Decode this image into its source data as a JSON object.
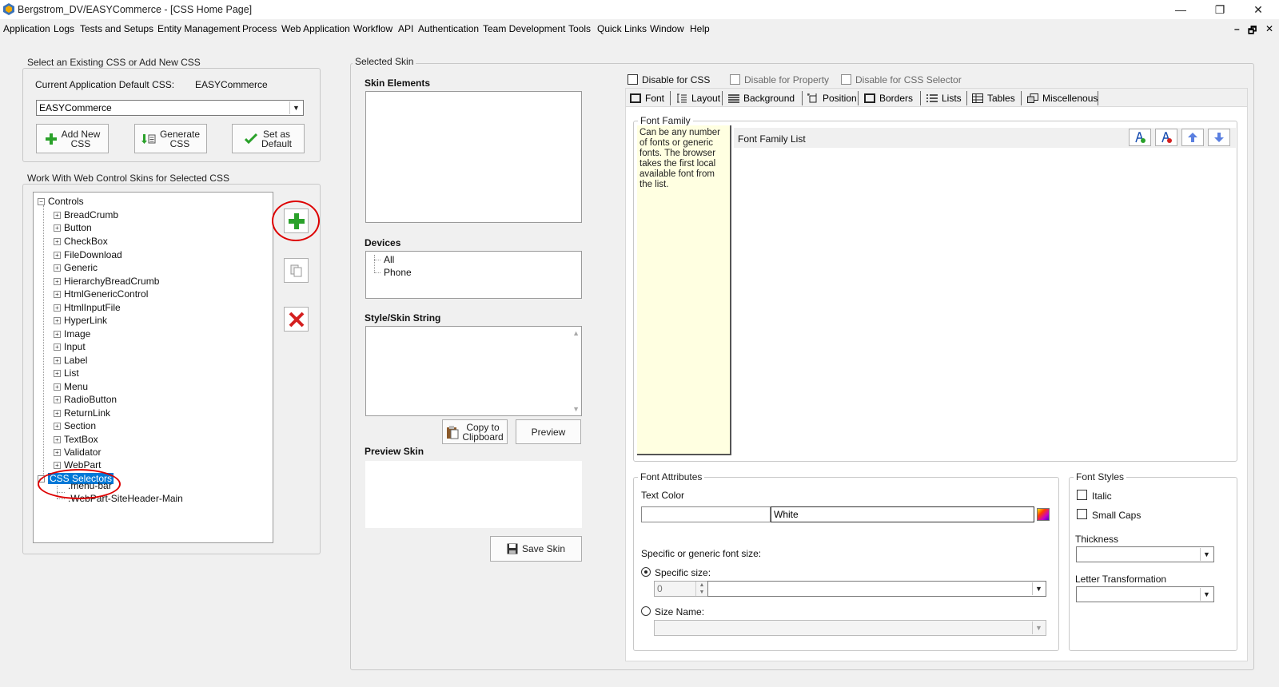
{
  "window": {
    "title": "Bergstrom_DV/EASYCommerce - [CSS Home Page]",
    "controls": {
      "minimize": "—",
      "restore": "❐",
      "close": "✕"
    },
    "mdi_controls": {
      "minimize": "–",
      "restore": "🗗",
      "close": "✕"
    }
  },
  "menu": [
    "Application",
    "Logs",
    "Tests and Setups",
    "Entity Management",
    "Process",
    "Web Application",
    "Workflow",
    "API",
    "Authentication",
    "Team Development",
    "Tools",
    "Quick Links",
    "Window",
    "Help"
  ],
  "css_select": {
    "legend": "Select an Existing CSS or Add New CSS",
    "default_label": "Current Application Default CSS:",
    "default_value": "EASYCommerce",
    "combo_value": "EASYCommerce",
    "buttons": {
      "add_new": "Add New\nCSS",
      "generate": "Generate\nCSS",
      "set_default": "Set as\nDefault"
    }
  },
  "skins": {
    "legend": "Work With Web Control Skins for Selected CSS",
    "root": "Controls",
    "controls": [
      "BreadCrumb",
      "Button",
      "CheckBox",
      "FileDownload",
      "Generic",
      "HierarchyBreadCrumb",
      "HtmlGenericControl",
      "HtmlInputFile",
      "HyperLink",
      "Image",
      "Input",
      "Label",
      "List",
      "Menu",
      "RadioButton",
      "ReturnLink",
      "Section",
      "TextBox",
      "Validator",
      "WebPart"
    ],
    "selectors_root": "CSS Selectors",
    "selectors": [
      ".menu-bar",
      ".WebPart-SiteHeader-Main"
    ]
  },
  "selected_skin": {
    "legend": "Selected Skin",
    "skin_elements_label": "Skin Elements",
    "devices_label": "Devices",
    "devices": [
      "All",
      "Phone"
    ],
    "style_string_label": "Style/Skin String",
    "copy_button": "Copy to\nClipboard",
    "preview_button": "Preview",
    "preview_label": "Preview Skin",
    "save_button": "Save Skin"
  },
  "disable": {
    "css": "Disable for CSS",
    "property": "Disable for Property",
    "selector": "Disable for CSS Selector"
  },
  "tabs": [
    "Font",
    "Layout",
    "Background",
    "Position",
    "Borders",
    "Lists",
    "Tables",
    "Miscellenous"
  ],
  "font_family": {
    "legend": "Font Family",
    "help": "Can be any number of fonts or generic fonts. The browser takes the first local available font from the list.",
    "list_label": "Font Family List"
  },
  "font_attributes": {
    "legend": "Font Attributes",
    "text_color_label": "Text Color",
    "text_color_value": "White",
    "size_label": "Specific or generic font size:",
    "specific_label": "Specific size:",
    "specific_value": "0",
    "size_name_label": "Size Name:"
  },
  "font_styles": {
    "legend": "Font Styles",
    "italic": "Italic",
    "small_caps": "Small Caps",
    "thickness_label": "Thickness",
    "letter_label": "Letter Transformation"
  },
  "colors": {
    "selection": "#0078d7",
    "annotation": "#d00000",
    "help_bg": "#ffffe1",
    "add_green": "#2aa12a",
    "delete_red": "#d42020"
  }
}
